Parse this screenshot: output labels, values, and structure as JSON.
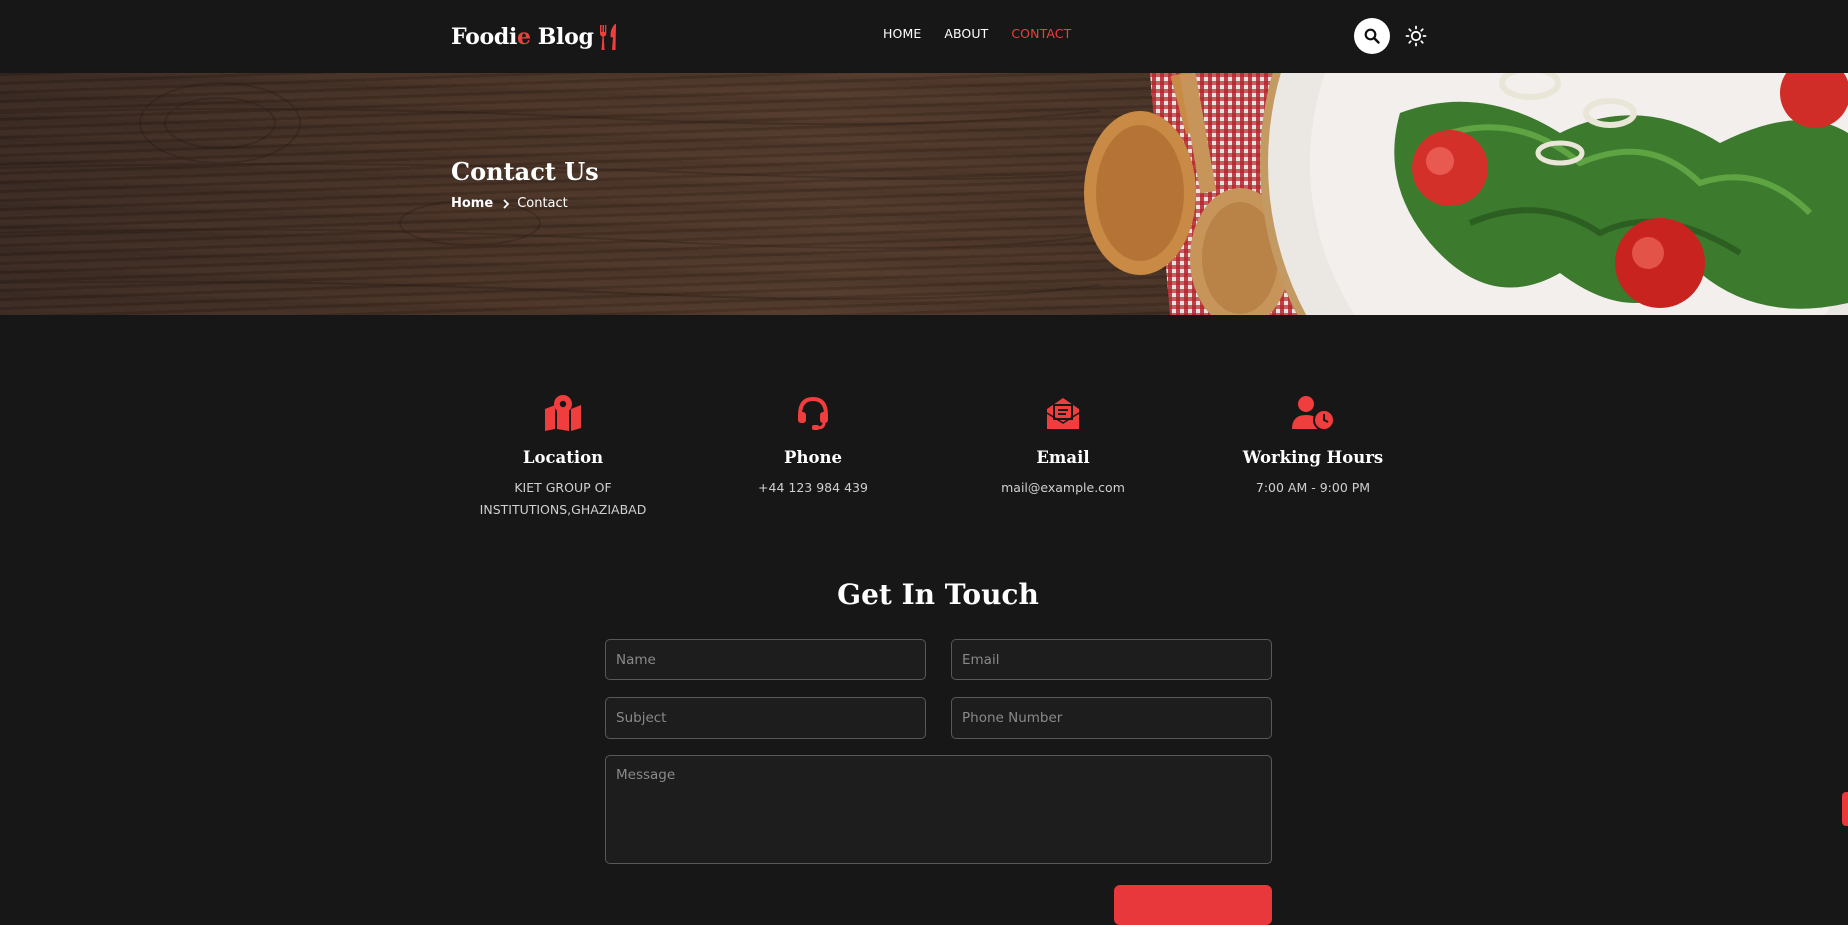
{
  "header": {
    "logo": {
      "part1": "Food",
      "accent_letter_i": "i",
      "accent_letter_e": "e",
      "part2": "Blog"
    },
    "nav": [
      {
        "label": "HOME",
        "active": false
      },
      {
        "label": "ABOUT",
        "active": false
      },
      {
        "label": "CONTACT",
        "active": true
      }
    ],
    "search_icon": "search-icon",
    "theme_icon": "sun-icon"
  },
  "hero": {
    "title": "Contact Us",
    "breadcrumb": {
      "home": "Home",
      "current": "Contact"
    }
  },
  "info": [
    {
      "icon": "map-pin-icon",
      "title": "Location",
      "text": "KIET GROUP OF INSTITUTIONS,GHAZIABAD"
    },
    {
      "icon": "headset-icon",
      "title": "Phone",
      "text": "+44 123 984 439"
    },
    {
      "icon": "envelope-open-icon",
      "title": "Email",
      "text": "mail@example.com"
    },
    {
      "icon": "user-clock-icon",
      "title": "Working Hours",
      "text": "7:00 AM - 9:00 PM"
    }
  ],
  "form": {
    "title": "Get In Touch",
    "name_placeholder": "Name",
    "email_placeholder": "Email",
    "subject_placeholder": "Subject",
    "phone_placeholder": "Phone Number",
    "message_placeholder": "Message"
  },
  "colors": {
    "background": "#181717",
    "accent": "#f03d3d",
    "field_bg": "#1e1d1d",
    "field_border": "#5a5858"
  }
}
